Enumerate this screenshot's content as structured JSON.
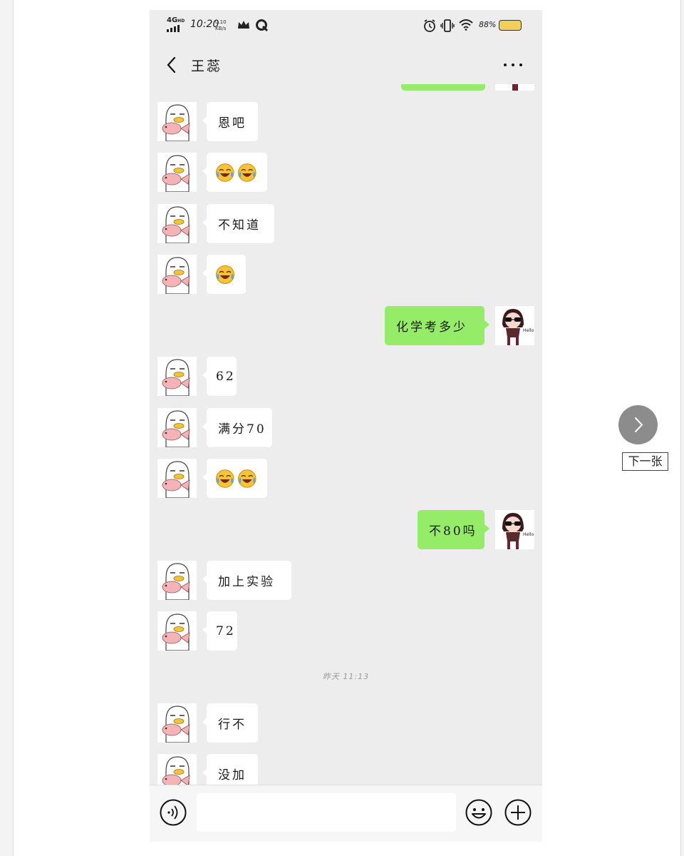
{
  "status_bar": {
    "network": "4G",
    "network_sup": "HD",
    "time": "10:20",
    "speed_value": "0.10",
    "speed_unit": "KB/s",
    "battery": "88%"
  },
  "header": {
    "contact_name": "王蕊"
  },
  "messages": [
    {
      "side": "recv",
      "text": "恩吧"
    },
    {
      "side": "recv",
      "emoji_count": 2,
      "emoji": "crying-laughing-emoji"
    },
    {
      "side": "recv",
      "text": "不知道"
    },
    {
      "side": "recv",
      "emoji_count": 1,
      "emoji": "crying-laughing-emoji"
    },
    {
      "side": "sent",
      "text": "化学考多少"
    },
    {
      "side": "recv",
      "text": "62"
    },
    {
      "side": "recv",
      "text": "满分70"
    },
    {
      "side": "recv",
      "emoji_count": 2,
      "emoji": "crying-laughing-emoji"
    },
    {
      "side": "sent",
      "text": "不80吗"
    },
    {
      "side": "recv",
      "text": "加上实验"
    },
    {
      "side": "recv",
      "text": "72"
    },
    {
      "side": "recv",
      "text": "行不"
    },
    {
      "side": "recv",
      "text": "没加"
    }
  ],
  "timestamp": "昨天 11:13",
  "input": {
    "placeholder": ""
  },
  "viewer": {
    "next_label": "下一张"
  },
  "colors": {
    "chat_background": "#ededed",
    "sent_bubble": "#95ec69",
    "received_bubble": "#ffffff"
  }
}
